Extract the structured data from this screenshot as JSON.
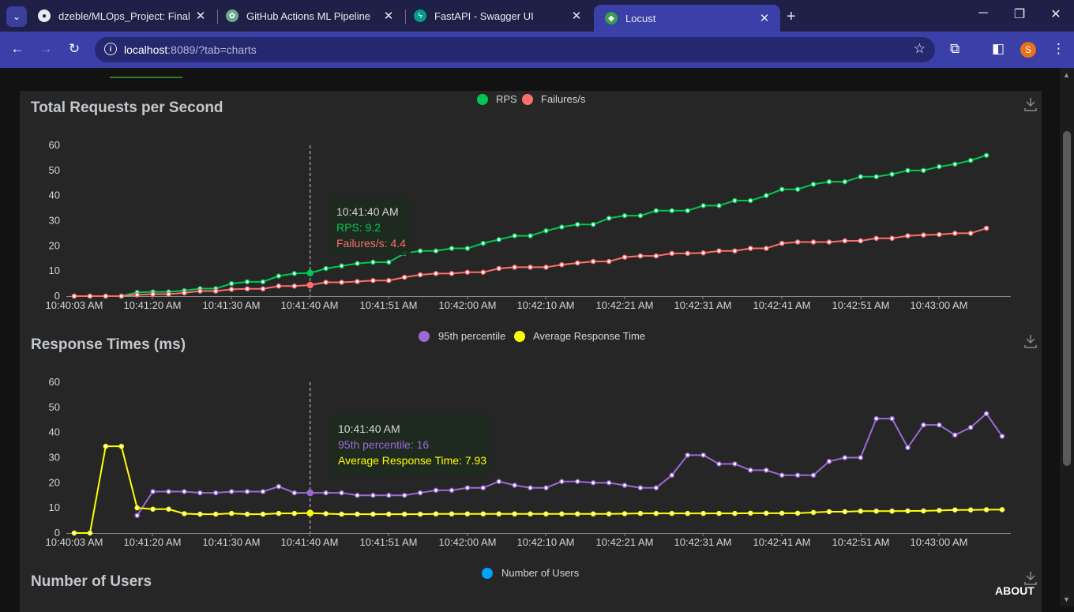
{
  "browser": {
    "tabs": [
      {
        "title": "dzeble/MLOps_Project: Final Pro",
        "icon": "github-icon"
      },
      {
        "title": "GitHub Actions ML Pipeline",
        "icon": "openai-icon"
      },
      {
        "title": "FastAPI - Swagger UI",
        "icon": "fastapi-icon"
      },
      {
        "title": "Locust",
        "icon": "locust-icon",
        "active": true
      }
    ],
    "url_host": "localhost",
    "url_rest": ":8089/?tab=charts",
    "profile_initial": "S"
  },
  "colors": {
    "rps": "#00c853",
    "failures": "#ff6d6d",
    "p95": "#9c6ad6",
    "avg": "#ffff00",
    "users": "#00a3ff"
  },
  "about_label": "ABOUT",
  "chart_data": [
    {
      "type": "line",
      "title": "Total Requests per Second",
      "x_ticks": [
        "10:40:03 AM",
        "10:41:20 AM",
        "10:41:30 AM",
        "10:41:40 AM",
        "10:41:51 AM",
        "10:42:00 AM",
        "10:42:10 AM",
        "10:42:21 AM",
        "10:42:31 AM",
        "10:42:41 AM",
        "10:42:51 AM",
        "10:43:00 AM"
      ],
      "ylim": [
        0,
        60
      ],
      "y_ticks": [
        0,
        10,
        20,
        30,
        40,
        50,
        60
      ],
      "legend": [
        "RPS",
        "Failures/s"
      ],
      "series": [
        {
          "name": "RPS",
          "values": [
            0,
            0,
            0,
            0,
            1.5,
            1.7,
            1.7,
            2.2,
            3,
            3,
            5,
            5.7,
            5.7,
            8,
            9,
            9.2,
            11,
            12,
            13,
            13.5,
            13.5,
            17,
            18,
            18,
            19,
            19,
            21,
            22.5,
            24,
            24,
            26,
            27.5,
            28.5,
            28.5,
            31,
            32,
            32,
            34,
            34,
            34,
            36,
            36,
            38,
            38,
            40,
            42.5,
            42.5,
            44.5,
            45.5,
            45.5,
            47.5,
            47.5,
            48.5,
            50,
            50,
            51.5,
            52.5,
            54,
            56
          ]
        },
        {
          "name": "Failures/s",
          "values": [
            0,
            0,
            0,
            0,
            0.5,
            0.8,
            0.8,
            1.3,
            2,
            2,
            2.7,
            2.9,
            2.9,
            4,
            4,
            4.4,
            5.5,
            5.5,
            5.8,
            6.2,
            6.2,
            7.5,
            8.5,
            9,
            9,
            9.5,
            9.5,
            11,
            11.5,
            11.5,
            11.5,
            12.5,
            13.2,
            13.8,
            13.8,
            15.5,
            16,
            16,
            17,
            17,
            17.2,
            18,
            18,
            19,
            19,
            21,
            21.5,
            21.5,
            21.5,
            22,
            22,
            23,
            23,
            24,
            24.3,
            24.5,
            25,
            25,
            27
          ]
        }
      ],
      "tooltip": {
        "time": "10:41:40 AM",
        "lines": [
          "RPS: 9.2",
          "Failures/s: 4.4"
        ],
        "index": 15
      }
    },
    {
      "type": "line",
      "title": "Response Times (ms)",
      "x_ticks": [
        "10:40:03 AM",
        "10:41:20 AM",
        "10:41:30 AM",
        "10:41:40 AM",
        "10:41:51 AM",
        "10:42:00 AM",
        "10:42:10 AM",
        "10:42:21 AM",
        "10:42:31 AM",
        "10:42:41 AM",
        "10:42:51 AM",
        "10:43:00 AM"
      ],
      "ylim": [
        0,
        60
      ],
      "y_ticks": [
        0,
        10,
        20,
        30,
        40,
        50,
        60
      ],
      "legend": [
        "95th percentile",
        "Average Response Time"
      ],
      "series": [
        {
          "name": "95th percentile",
          "start": 4,
          "values": [
            7,
            16.5,
            16.5,
            16.5,
            16,
            16,
            16.5,
            16.5,
            16.5,
            18.5,
            16,
            16,
            16,
            16,
            15,
            15,
            15,
            15,
            16,
            17,
            17,
            18,
            18,
            20.5,
            19,
            18,
            18,
            20.5,
            20.5,
            20,
            20,
            19,
            18,
            18,
            23,
            31,
            31,
            27.5,
            27.5,
            25,
            25,
            23,
            23,
            23,
            28.5,
            30,
            30,
            45.5,
            45.5,
            34,
            43,
            43,
            39,
            42,
            47.5,
            38.5
          ]
        },
        {
          "name": "Average Response Time",
          "start": 0,
          "values": [
            0,
            0,
            34.5,
            34.5,
            10,
            9.5,
            9.5,
            7.7,
            7.5,
            7.5,
            7.8,
            7.5,
            7.5,
            7.8,
            7.8,
            7.93,
            7.7,
            7.5,
            7.5,
            7.5,
            7.5,
            7.5,
            7.5,
            7.6,
            7.6,
            7.6,
            7.6,
            7.6,
            7.6,
            7.6,
            7.6,
            7.6,
            7.6,
            7.6,
            7.6,
            7.7,
            7.8,
            7.8,
            7.8,
            7.8,
            7.8,
            7.8,
            7.8,
            7.9,
            7.9,
            7.9,
            7.9,
            8.2,
            8.5,
            8.5,
            8.7,
            8.7,
            8.7,
            8.8,
            8.8,
            9,
            9.2,
            9.2,
            9.3,
            9.3
          ]
        }
      ],
      "tooltip": {
        "time": "10:41:40 AM",
        "lines": [
          "95th percentile: 16",
          "Average Response Time: 7.93"
        ],
        "index": 15
      }
    },
    {
      "type": "line",
      "title": "Number of Users",
      "legend": [
        "Number of Users"
      ],
      "series": []
    }
  ]
}
